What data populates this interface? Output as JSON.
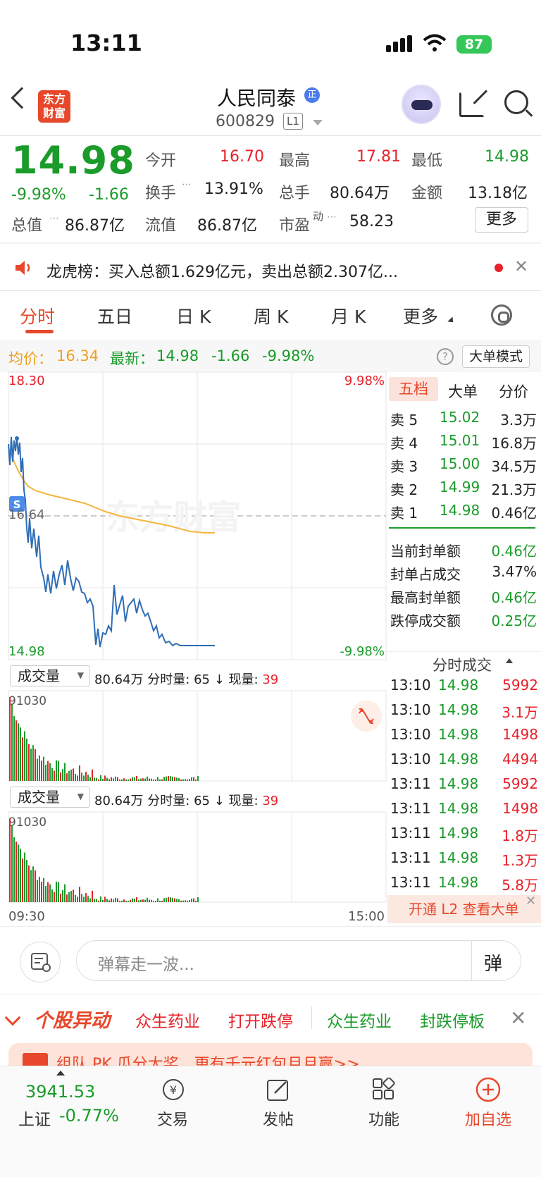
{
  "status": {
    "time": "13:11",
    "battery": "87"
  },
  "header": {
    "logo_text": "东方财富",
    "title": "人民同泰",
    "badge": "正",
    "code": "600829",
    "level": "L1"
  },
  "quote": {
    "price": "14.98",
    "change_pct": "-9.98%",
    "change": "-1.66",
    "open_label": "今开",
    "open": "16.70",
    "high_label": "最高",
    "high": "17.81",
    "low_label": "最低",
    "low": "14.98",
    "turnover_label": "换手",
    "turnover": "13.91%",
    "volume_label": "总手",
    "volume": "80.64万",
    "amount_label": "金额",
    "amount": "13.18亿",
    "mktcap_label": "总值",
    "mktcap": "86.87亿",
    "float_label": "流值",
    "float": "86.87亿",
    "pe_label": "市盈",
    "pe_sup": "动",
    "pe": "58.23",
    "more_btn": "更多"
  },
  "notice": {
    "text": "龙虎榜：买入总额1.629亿元，卖出总额2.307亿..."
  },
  "tabs": [
    "分时",
    "五日",
    "日 K",
    "周 K",
    "月 K",
    "更多"
  ],
  "info_strip": {
    "avg_label": "均价：",
    "avg": "16.34",
    "latest_label": "最新：",
    "latest": "14.98",
    "chg": "-1.66",
    "pct": "-9.98%",
    "mode_btn": "大单模式"
  },
  "chart": {
    "y_top": "18.30",
    "y_mid": "16.64",
    "y_bot": "14.98",
    "pct_top": "9.98%",
    "pct_bot": "-9.98%",
    "t_start": "09:30",
    "t_end": "15:00",
    "vol_max": "91030",
    "s_marker": "S",
    "watermark": "东方财富"
  },
  "volume_bar": {
    "label": "成交量",
    "total": "80.64万",
    "fen_label": "分时量:",
    "fen": "65",
    "arrow": "↓",
    "cur_label": "现量:",
    "cur": "39"
  },
  "right_panel": {
    "tabs": [
      "五档",
      "大单",
      "分价"
    ],
    "asks": [
      {
        "label": "卖 5",
        "price": "15.02",
        "vol": "3.3万"
      },
      {
        "label": "卖 4",
        "price": "15.01",
        "vol": "16.8万"
      },
      {
        "label": "卖 3",
        "price": "15.00",
        "vol": "34.5万"
      },
      {
        "label": "卖 2",
        "price": "14.99",
        "vol": "21.3万"
      },
      {
        "label": "卖 1",
        "price": "14.98",
        "vol": "0.46亿"
      }
    ],
    "seal": [
      {
        "label": "当前封单额",
        "value": "0.46亿"
      },
      {
        "label": "封单占成交",
        "value": "3.47%"
      },
      {
        "label": "最高封单额",
        "value": "0.46亿"
      },
      {
        "label": "跌停成交额",
        "value": "0.25亿"
      }
    ],
    "trades_title": "分时成交",
    "trades": [
      {
        "t": "13:10",
        "p": "14.98",
        "v": "5992"
      },
      {
        "t": "13:10",
        "p": "14.98",
        "v": "3.1万"
      },
      {
        "t": "13:10",
        "p": "14.98",
        "v": "1498"
      },
      {
        "t": "13:10",
        "p": "14.98",
        "v": "4494"
      },
      {
        "t": "13:11",
        "p": "14.98",
        "v": "5992"
      },
      {
        "t": "13:11",
        "p": "14.98",
        "v": "1498"
      },
      {
        "t": "13:11",
        "p": "14.98",
        "v": "1.8万"
      },
      {
        "t": "13:11",
        "p": "14.98",
        "v": "1.3万"
      },
      {
        "t": "13:11",
        "p": "14.98",
        "v": "5.8万"
      }
    ],
    "cta": "开通 L2 查看大单"
  },
  "danmaku": {
    "placeholder": "弹幕走一波...",
    "btn": "弹"
  },
  "ticker": {
    "title": "个股异动",
    "items": [
      "众生药业",
      "打开跌停",
      "众生药业",
      "封跌停板"
    ]
  },
  "banner": {
    "text": "组队 PK 瓜分大奖，更有千元红包月月赢>>"
  },
  "bottom_nav": {
    "index_value": "3941.53",
    "index_name": "上证",
    "index_pct": "-0.77%",
    "items": [
      "交易",
      "发帖",
      "功能",
      "加自选"
    ]
  },
  "colors": {
    "up": "#e8212a",
    "down": "#1a9b2a",
    "accent": "#e8472b",
    "avg_line": "#f5b53f",
    "price_line": "#2f6db5"
  }
}
